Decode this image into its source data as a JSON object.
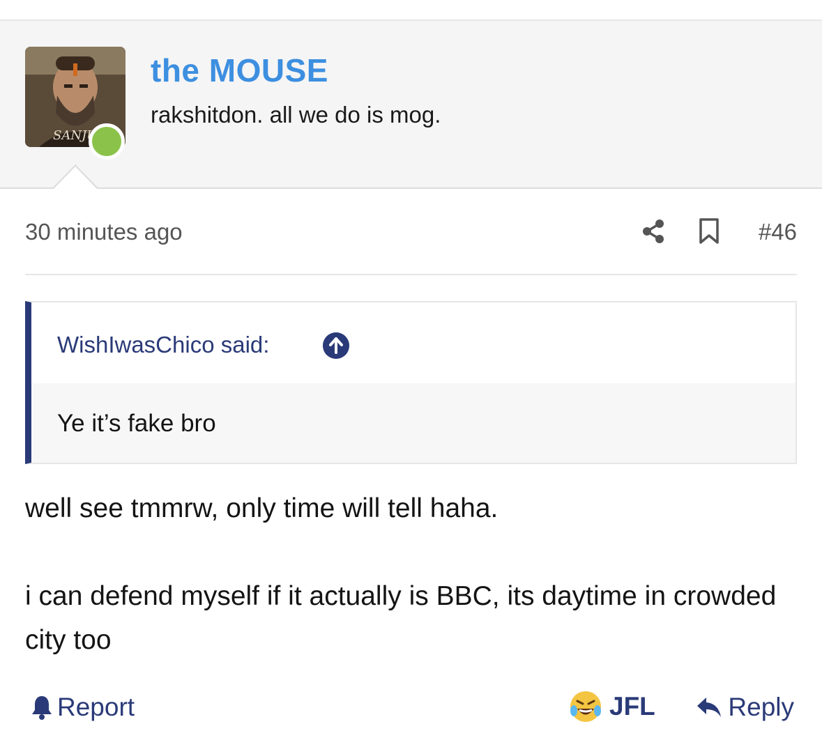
{
  "user": {
    "name": "the MOUSE",
    "title": "rakshitdon. all we do is mog.",
    "avatar_caption": "SANJU",
    "online_color": "#8bc34a"
  },
  "post": {
    "timestamp": "30 minutes ago",
    "number": "#46",
    "share_icon": "share-icon",
    "bookmark_icon": "bookmark-icon"
  },
  "quote": {
    "author_line": "WishIwasChico said:",
    "text": "Ye it’s fake bro",
    "accent_color": "#2a3a78"
  },
  "message": {
    "paragraphs": [
      "well see tmmrw, only time will tell haha.",
      "i can defend myself if it actually is BBC, its daytime in crowded city too"
    ]
  },
  "actions": {
    "report_label": "Report",
    "reaction_label": "JFL",
    "reply_label": "Reply"
  },
  "colors": {
    "username": "#3d8fe0",
    "link": "#2a3a78"
  }
}
